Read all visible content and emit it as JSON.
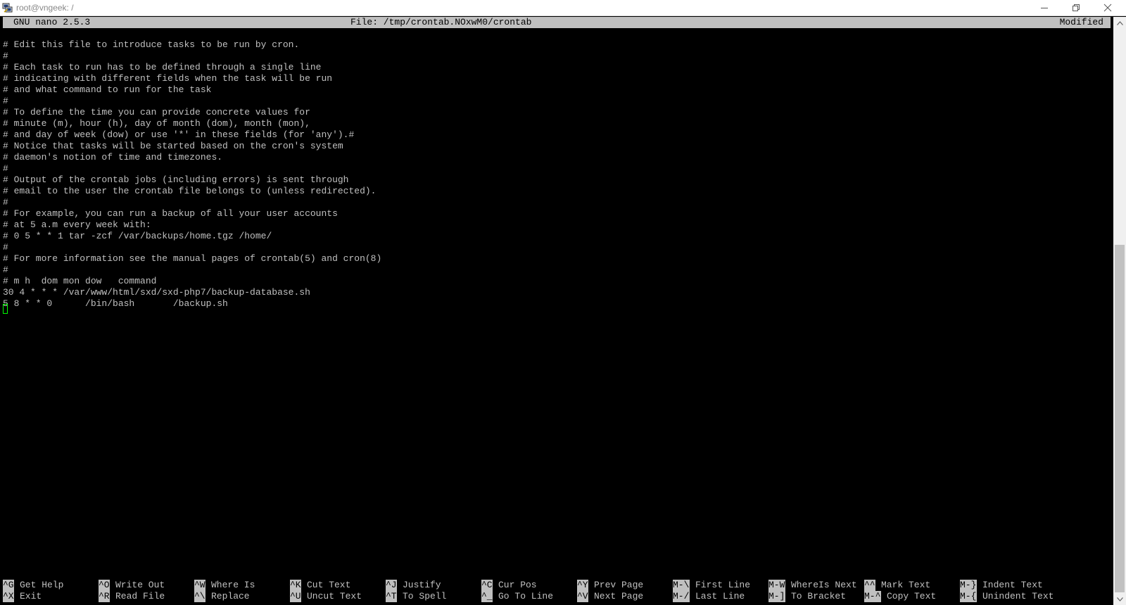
{
  "window": {
    "title": "root@vngeek: /"
  },
  "nano": {
    "version": "GNU nano 2.5.3",
    "file_label": "File: /tmp/crontab.NOxwM0/crontab",
    "status": "Modified"
  },
  "buffer_lines": [
    "# Edit this file to introduce tasks to be run by cron.",
    "#",
    "# Each task to run has to be defined through a single line",
    "# indicating with different fields when the task will be run",
    "# and what command to run for the task",
    "#",
    "# To define the time you can provide concrete values for",
    "# minute (m), hour (h), day of month (dom), month (mon),",
    "# and day of week (dow) or use '*' in these fields (for 'any').#",
    "# Notice that tasks will be started based on the cron's system",
    "# daemon's notion of time and timezones.",
    "#",
    "# Output of the crontab jobs (including errors) is sent through",
    "# email to the user the crontab file belongs to (unless redirected).",
    "#",
    "# For example, you can run a backup of all your user accounts",
    "# at 5 a.m every week with:",
    "# 0 5 * * 1 tar -zcf /var/backups/home.tgz /home/",
    "#",
    "# For more information see the manual pages of crontab(5) and cron(8)",
    "#",
    "# m h  dom mon dow   command",
    "30 4 * * * /var/www/html/sxd/sxd-php7/backup-database.sh",
    "5 8 * * 0      /bin/bash       /backup.sh"
  ],
  "shortcuts": {
    "row1": [
      {
        "key": "^G",
        "label": "Get Help"
      },
      {
        "key": "^O",
        "label": "Write Out"
      },
      {
        "key": "^W",
        "label": "Where Is"
      },
      {
        "key": "^K",
        "label": "Cut Text"
      },
      {
        "key": "^J",
        "label": "Justify"
      },
      {
        "key": "^C",
        "label": "Cur Pos"
      },
      {
        "key": "^Y",
        "label": "Prev Page"
      },
      {
        "key": "M-\\",
        "label": "First Line"
      },
      {
        "key": "M-W",
        "label": "WhereIs Next"
      },
      {
        "key": "^^",
        "label": "Mark Text"
      },
      {
        "key": "M-}",
        "label": "Indent Text"
      }
    ],
    "row2": [
      {
        "key": "^X",
        "label": "Exit"
      },
      {
        "key": "^R",
        "label": "Read File"
      },
      {
        "key": "^\\",
        "label": "Replace"
      },
      {
        "key": "^U",
        "label": "Uncut Text"
      },
      {
        "key": "^T",
        "label": "To Spell"
      },
      {
        "key": "^_",
        "label": "Go To Line"
      },
      {
        "key": "^V",
        "label": "Next Page"
      },
      {
        "key": "M-/",
        "label": "Last Line"
      },
      {
        "key": "M-]",
        "label": "To Bracket"
      },
      {
        "key": "M-^",
        "label": "Copy Text"
      },
      {
        "key": "M-{",
        "label": "Unindent Text"
      }
    ]
  },
  "colors": {
    "terminal_bg": "#000000",
    "terminal_fg": "#c0c0c0",
    "header_bg": "#c0c0c0",
    "cursor": "#00ff00"
  }
}
